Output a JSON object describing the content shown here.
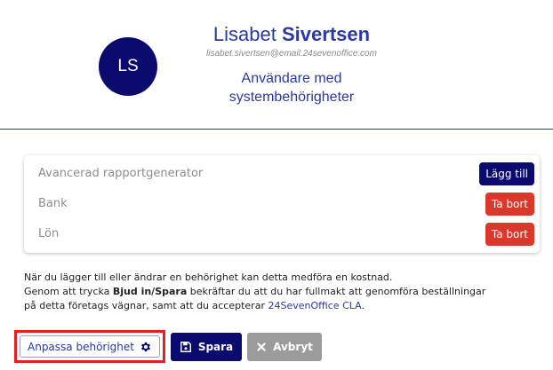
{
  "user": {
    "initials": "LS",
    "first_name": "Lisabet",
    "last_name": "Sivertsen",
    "email": "lisabet.sivertsen@email.24sevenoffice.com",
    "role_line1": "Användare med",
    "role_line2": "systembehörigheter"
  },
  "permissions": [
    {
      "label": "Avancerad rapportgenerator",
      "action": "Lägg till"
    },
    {
      "label": "Bank",
      "action": "Ta bort"
    },
    {
      "label": "Lön",
      "action": "Ta bort"
    }
  ],
  "notice": {
    "line1": "När du lägger till eller ändrar en behörighet kan detta medföra en kostnad.",
    "line2_pre": "Genom att trycka ",
    "line2_bold": "Bjud in/Spara",
    "line2_post": " bekräftar du att du har fullmakt att genomföra beställningar",
    "line3_pre": "på detta företags vägnar, samt att du accepterar ",
    "line3_link": "24SevenOffice CLA",
    "line3_post": "."
  },
  "actions": {
    "adjust_label": "Anpassa behörighet",
    "save_label": "Spara",
    "cancel_label": "Avbryt"
  },
  "icons": {
    "adjust": "gear-icon",
    "save": "floppy-disk-icon",
    "cancel": "close-icon"
  },
  "colors": {
    "primary": "#0b0a6e",
    "accent_text": "#2a3a9f",
    "danger": "#d73a2b",
    "highlight_border": "#e22020",
    "muted_button": "#9b9b9b"
  }
}
